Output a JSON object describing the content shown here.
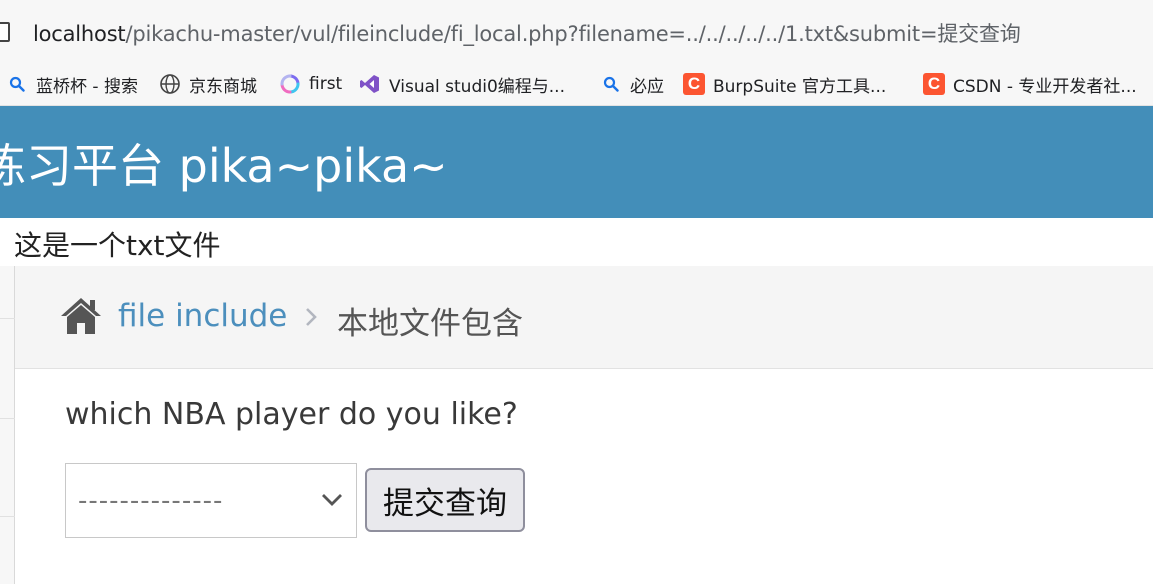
{
  "browser": {
    "url_host": "localhost",
    "url_rest": "/pikachu-master/vul/fileinclude/fi_local.php?filename=../../../../../1.txt&submit=提交查询"
  },
  "bookmarks": [
    {
      "label": "蓝桥杯 - 搜索",
      "icon": "search-icon"
    },
    {
      "label": "京东商城",
      "icon": "globe-icon"
    },
    {
      "label": "first",
      "icon": "spinner-icon"
    },
    {
      "label": "Visual studi0编程与...",
      "icon": "visual-studio-icon"
    },
    {
      "label": "必应",
      "icon": "search-icon"
    },
    {
      "label": "BurpSuite 官方工具...",
      "icon": "csdn-icon"
    },
    {
      "label": "CSDN - 专业开发者社...",
      "icon": "csdn-icon"
    }
  ],
  "header": {
    "title": "练习平台 pika~pika~"
  },
  "included_content": "这是一个txt文件",
  "breadcrumb": {
    "link": "file include",
    "active": "本地文件包含"
  },
  "form": {
    "question": "which NBA player do you like?",
    "select_value": "--------------",
    "submit_label": "提交查询"
  },
  "colors": {
    "header_bg": "#438eb9",
    "link": "#4c8fbd",
    "csdn": "#fc5531"
  }
}
